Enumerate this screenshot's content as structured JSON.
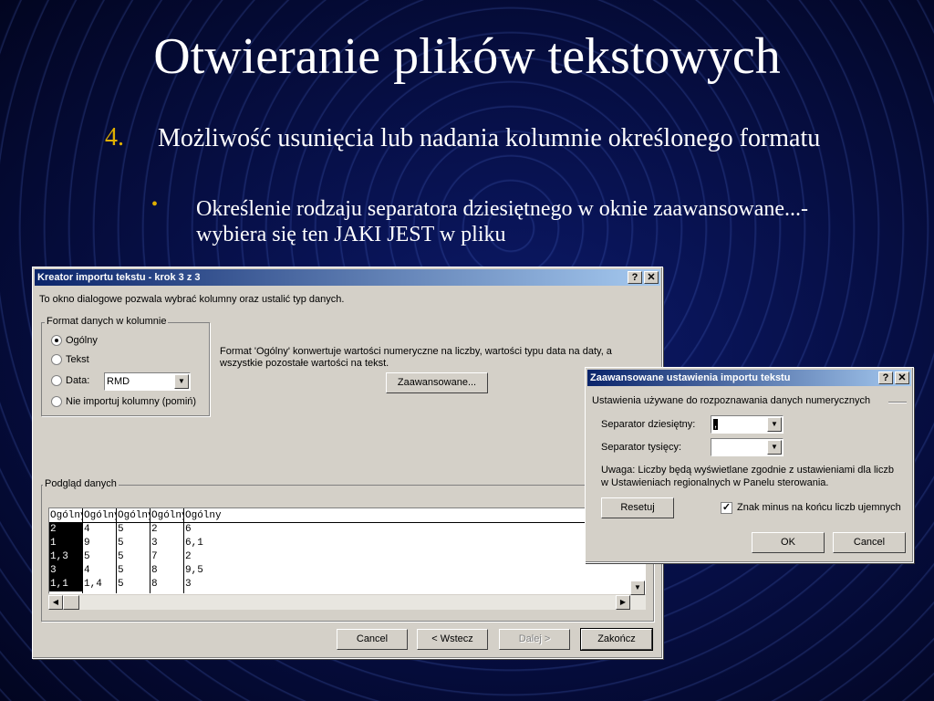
{
  "slide": {
    "title": "Otwieranie plików tekstowych",
    "number": "4.",
    "point": "Możliwość usunięcia lub nadania kolumnie określonego formatu",
    "bullet": "•",
    "subpoint": "Określenie rodzaju separatora dziesiętnego w oknie zaawansowane...- wybiera się ten JAKI JEST w pliku"
  },
  "wizard": {
    "title": "Kreator importu tekstu - krok 3 z 3",
    "help": "?",
    "close": "✕",
    "intro": "To okno dialogowe pozwala wybrać kolumny oraz ustalić typ danych.",
    "format_group": "Format danych w kolumnie",
    "options": [
      "Ogólny",
      "Tekst",
      "Data:",
      "Nie importuj kolumny (pomiń)"
    ],
    "selected_option": "Ogólny",
    "date_format": "RMD",
    "description": [
      "Format 'Ogólny' konwertuje wartości numeryczne na liczby, wartości typu data na daty, a",
      "wszystkie pozostałe wartości na tekst."
    ],
    "advanced_button": "Zaawansowane...",
    "preview_group": "Podgląd danych",
    "preview": {
      "headers": [
        "Ogólny",
        "Ogólny",
        "Ogólny",
        "Ogólny",
        "Ogólny"
      ],
      "rows": [
        [
          "2",
          "4",
          "5",
          "2",
          "6"
        ],
        [
          "1",
          "9",
          "5",
          "3",
          "6,1"
        ],
        [
          "1,3",
          "5",
          "5",
          "7",
          "2"
        ],
        [
          "3",
          "4",
          "5",
          "8",
          "9,5"
        ],
        [
          "1,1",
          "1,4",
          "5",
          "8",
          "3"
        ]
      ]
    },
    "buttons": {
      "cancel": "Cancel",
      "back": "< Wstecz",
      "next": "Dalej >",
      "finish": "Zakończ"
    }
  },
  "advanced": {
    "title": "Zaawansowane ustawienia importu tekstu",
    "help": "?",
    "close": "✕",
    "group": "Ustawienia używane do rozpoznawania danych numerycznych",
    "decimal_label": "Separator dziesiętny:",
    "decimal_value": ",",
    "thousands_label": "Separator tysięcy:",
    "thousands_value": "",
    "note": [
      "Uwaga: Liczby będą wyświetlane zgodnie z ustawieniami dla liczb",
      "w Ustawieniach regionalnych w Panelu sterowania."
    ],
    "reset": "Resetuj",
    "minus_label": "Znak minus na końcu liczb ujemnych",
    "minus_checked": "✓",
    "ok": "OK",
    "cancel": "Cancel"
  }
}
